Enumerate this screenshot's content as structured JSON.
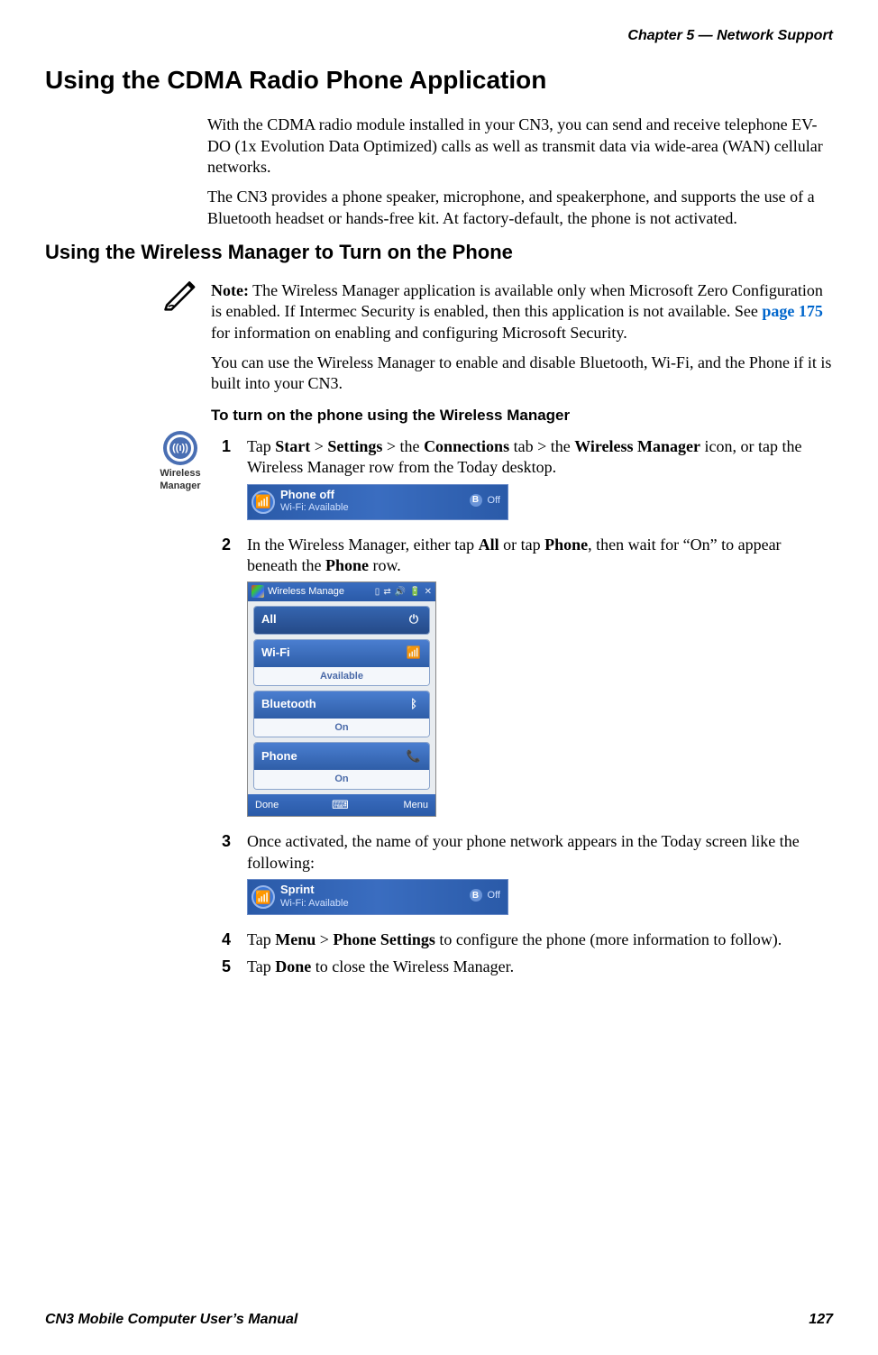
{
  "header": {
    "chapter": "Chapter 5 —  Network Support"
  },
  "h1": "Using the CDMA Radio Phone Application",
  "intro_p1": "With the CDMA radio module installed in your CN3, you can send and receive telephone EV-DO (1x Evolution Data Optimized) calls as well as transmit data via wide-area (WAN) cellular networks.",
  "intro_p2": "The CN3 provides a phone speaker, microphone, and speakerphone, and supports the use of a Bluetooth headset or hands-free kit. At factory-default, the phone is not activated.",
  "h2": "Using the Wireless Manager to Turn on the Phone",
  "note": {
    "label": "Note:",
    "text_before_link": " The Wireless Manager application is available only when Microsoft Zero Configuration is enabled. If Intermec Security is enabled, then this application is not available. See ",
    "link": "page 175",
    "text_after_link": " for information on enabling and configuring Microsoft Security."
  },
  "after_note": "You can use the Wireless Manager to enable and disable Bluetooth, Wi-Fi, and the Phone if it is built into your CN3.",
  "h3": "To turn on the phone using the Wireless Manager",
  "wm_icon_label": "Wireless Manager",
  "steps": {
    "s1": {
      "num": "1",
      "pre": "Tap ",
      "b1": "Start",
      "gt1": " > ",
      "b2": "Settings",
      "gt2": " > the ",
      "b3": "Connections",
      "mid": " tab > the ",
      "b4": "Wireless Manager",
      "post": " icon, or tap the Wireless Manager row from the Today desktop."
    },
    "s2": {
      "num": "2",
      "pre": "In the Wireless Manager, either tap ",
      "b1": "All",
      "mid1": " or tap ",
      "b2": "Phone",
      "mid2": ", then wait for “On” to appear beneath the ",
      "b3": "Phone",
      "post": " row."
    },
    "s3": {
      "num": "3",
      "text": "Once activated, the name of your phone network appears in the Today screen like the following:"
    },
    "s4": {
      "num": "4",
      "pre": "Tap ",
      "b1": "Menu",
      "gt": " > ",
      "b2": "Phone Settings",
      "post": " to configure the phone (more information to follow)."
    },
    "s5": {
      "num": "5",
      "pre": "Tap ",
      "b1": "Done",
      "post": " to close the Wireless Manager."
    }
  },
  "today1": {
    "title": "Phone off",
    "sub": "Wi-Fi: Available",
    "bt": "Off"
  },
  "wm_screen": {
    "title": "Wireless Manage",
    "rows": {
      "all": "All",
      "wifi": {
        "label": "Wi-Fi",
        "status": "Available"
      },
      "bt": {
        "label": "Bluetooth",
        "status": "On"
      },
      "phone": {
        "label": "Phone",
        "status": "On"
      }
    },
    "bottom": {
      "left": "Done",
      "right": "Menu"
    }
  },
  "today2": {
    "title": "Sprint",
    "sub": "Wi-Fi: Available",
    "bt": "Off"
  },
  "footer": {
    "left": "CN3 Mobile Computer User’s Manual",
    "right": "127"
  }
}
